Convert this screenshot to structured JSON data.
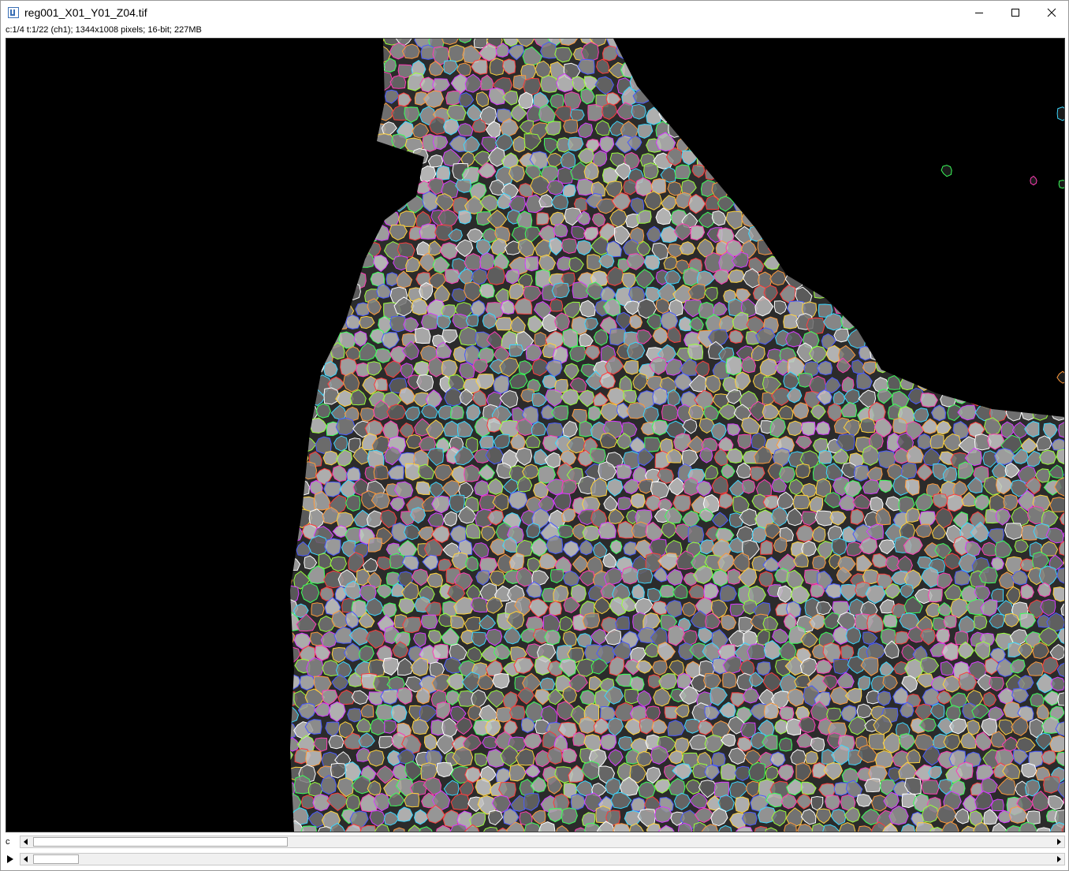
{
  "window": {
    "title": "reg001_X01_Y01_Z04.tif",
    "icon": "imagej-icon",
    "controls": {
      "minimize": "minimize-icon",
      "maximize": "maximize-icon",
      "close": "close-icon"
    }
  },
  "info": {
    "text": "c:1/4 t:1/22 (ch1); 1344x1008 pixels; 16-bit; 227MB"
  },
  "image": {
    "description_colors": {
      "background": "#000000",
      "nuclei": "#8c8c8c",
      "outline_palette": [
        "#ff3b3b",
        "#ffd23b",
        "#3bff5a",
        "#3bd7ff",
        "#4a5bff",
        "#d83bff",
        "#ff3bb5",
        "#ffffff",
        "#ff9a3b",
        "#9aff3b"
      ]
    }
  },
  "sliders": {
    "channel": {
      "label": "c",
      "position": 0.25
    },
    "time": {
      "label": "▶",
      "position": 0.045
    }
  },
  "colors": {
    "window_bg": "#ffffff",
    "scroll_track": "#f0f0f0",
    "thumb": "#ffffff"
  }
}
